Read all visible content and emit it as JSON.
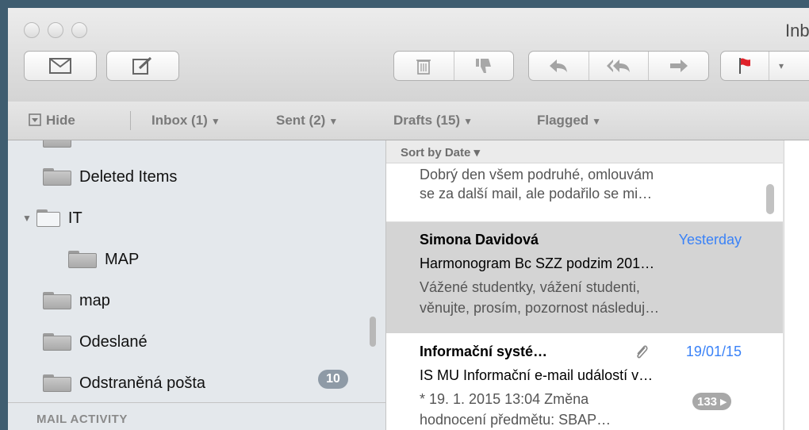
{
  "window": {
    "title": "Inbox"
  },
  "toolbar": {
    "new_message": "new-message",
    "compose": "compose",
    "delete": "trash",
    "junk": "thumbs-down",
    "reply": "reply",
    "reply_all": "reply-all",
    "forward": "forward",
    "flag": "flag"
  },
  "favorites": {
    "hide": "Hide",
    "inbox": "Inbox (1)",
    "sent": "Sent (2)",
    "drafts": "Drafts (15)",
    "flagged": "Flagged"
  },
  "sidebar": {
    "items": [
      {
        "label": "Deleted Items"
      },
      {
        "label": "IT"
      },
      {
        "label": "MAP"
      },
      {
        "label": "map"
      },
      {
        "label": "Odeslané"
      },
      {
        "label": "Odstraněná pošta",
        "badge": "10"
      }
    ],
    "footer": "MAIL ACTIVITY"
  },
  "list": {
    "sort_label": "Sort by Date ▾",
    "messages": [
      {
        "preview1": "Dobrý den všem podruhé, omlouvám",
        "preview2": "se za další mail, ale podařilo se mi…"
      },
      {
        "sender": "Simona Davidová",
        "date": "Yesterday",
        "subject": "Harmonogram Bc SZZ podzim 201…",
        "preview1": "Vážené studentky, vážení studenti,",
        "preview2": "věnujte, prosím, pozornost následuj…"
      },
      {
        "sender": "Informační systé…",
        "date": "19/01/15",
        "subject": "IS MU Informační e-mail událostí v…",
        "preview1": "* 19. 1. 2015 13:04 Změna",
        "preview2": "hodnocení předmětu: SBAP…",
        "count": "133 ▸"
      }
    ]
  },
  "colors": {
    "accent": "#3a82f7",
    "selected_row": "#d4d4d4",
    "sidebar_bg": "#e4e8ec",
    "desktop": "#3f5d70"
  }
}
